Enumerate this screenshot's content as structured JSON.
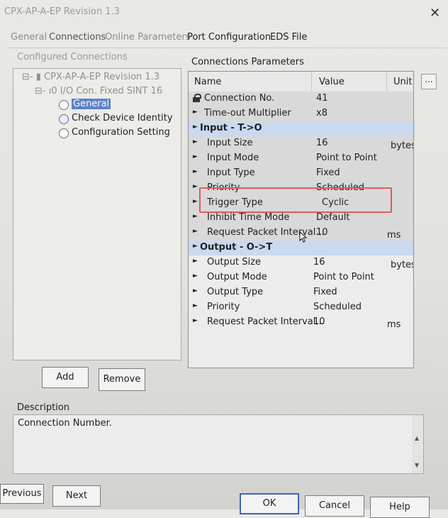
{
  "window": {
    "title": "CPX-AP-A-EP Revision 1.3",
    "close_glyph": "✕"
  },
  "tabs": [
    {
      "label": "General"
    },
    {
      "label": "Connections"
    },
    {
      "label": "Online Parameters"
    },
    {
      "label": "Port Configuration"
    },
    {
      "label": "EDS File"
    }
  ],
  "left_panel": {
    "title": "Configured Connections",
    "tree": {
      "root": "CPX-AP-A-EP Revision 1.3",
      "connection": "I/O Con. Fixed SINT 16",
      "items": [
        "General",
        "Check Device Identity",
        "Configuration Setting"
      ],
      "selected": "General"
    }
  },
  "right_panel": {
    "title": "Connections Parameters",
    "columns": {
      "name": "Name",
      "value": "Value",
      "unit": "Unit"
    },
    "more_button": "...",
    "rows": [
      {
        "name": "Connection No.",
        "value": "41",
        "unit": ""
      },
      {
        "name": "Time-out Multiplier",
        "value": "x8",
        "unit": ""
      },
      {
        "name": "Input - T->O",
        "value": "",
        "unit": ""
      },
      {
        "name": "Input Size",
        "value": "16",
        "unit": "bytes"
      },
      {
        "name": "Input Mode",
        "value": "Point to Point",
        "unit": ""
      },
      {
        "name": "Input Type",
        "value": "Fixed",
        "unit": ""
      },
      {
        "name": "Priority",
        "value": "Scheduled",
        "unit": ""
      },
      {
        "name": "Trigger Type",
        "value": "Cyclic",
        "unit": ""
      },
      {
        "name": "Inhibit Time Mode",
        "value": "Default",
        "unit": ""
      },
      {
        "name": "Request Packet Interval...",
        "value": "10",
        "unit": "ms"
      },
      {
        "name": "Output - O->T",
        "value": "",
        "unit": ""
      },
      {
        "name": "Output Size",
        "value": "16",
        "unit": "bytes"
      },
      {
        "name": "Output Mode",
        "value": "Point to Point",
        "unit": ""
      },
      {
        "name": "Output Type",
        "value": "Fixed",
        "unit": ""
      },
      {
        "name": "Priority",
        "value": "Scheduled",
        "unit": ""
      },
      {
        "name": "Request Packet Interval...",
        "value": "10",
        "unit": "ms"
      }
    ]
  },
  "buttons": {
    "add": "Add",
    "remove": "Remove",
    "previous": "Previous",
    "next": "Next",
    "ok": "OK",
    "cancel": "Cancel",
    "help": "Help"
  },
  "description": {
    "label": "Description",
    "text": "Connection Number."
  },
  "colors": {
    "group_row": "#c9daf0",
    "highlight": "#e05a5a",
    "selected": "#5c82c8"
  }
}
